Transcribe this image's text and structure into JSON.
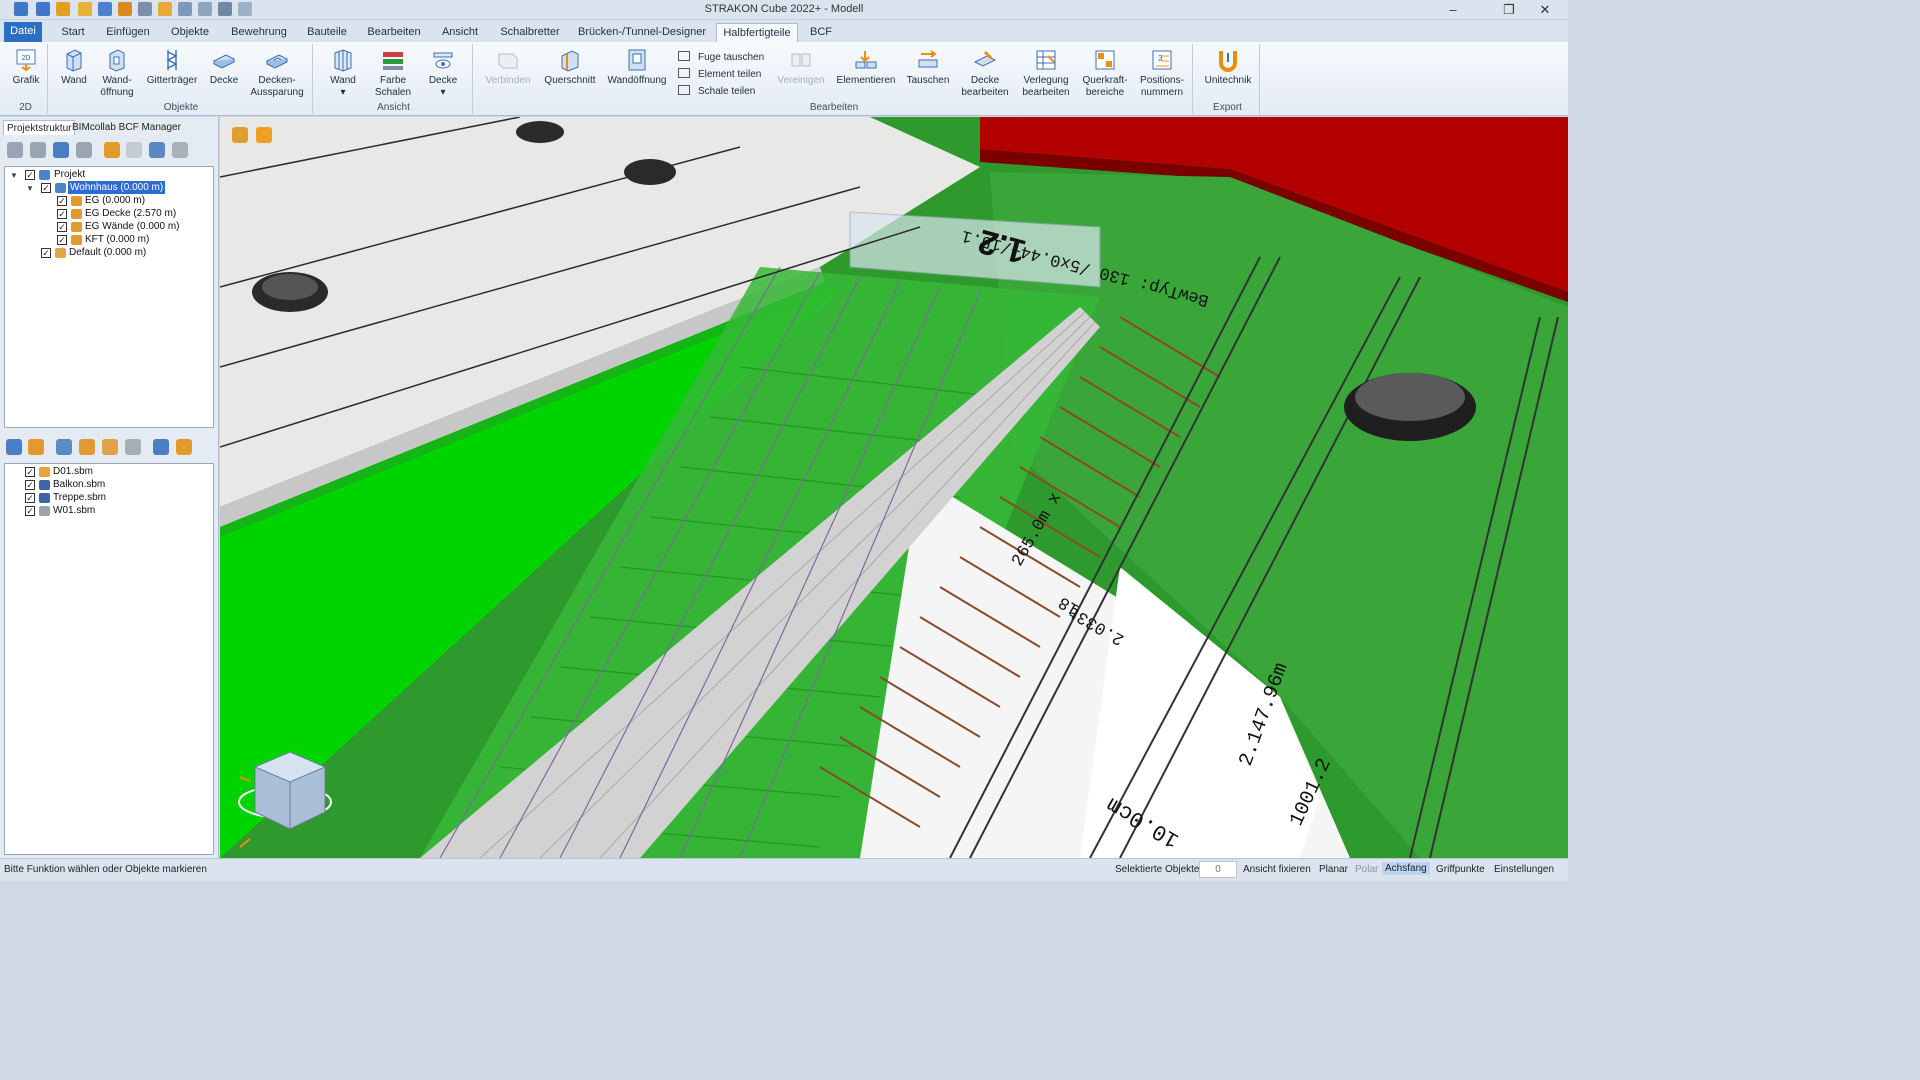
{
  "window": {
    "title": "STRAKON Cube 2022+ - Modell",
    "colors": {
      "chrome": "#dbe4ee",
      "file_tab": "#2b6ec4",
      "selection": "#2c6cd4",
      "green_slab": "#2e9a2e",
      "bright_green": "#00d400",
      "red_wall": "#b30000"
    }
  },
  "quick_access": {
    "icons": [
      "undo-icon",
      "redo-icon",
      "save-icon",
      "save-as-icon",
      "open-icon",
      "import-icon",
      "export-icon",
      "print-icon",
      "copy-icon",
      "paste-icon",
      "properties-icon",
      "layers-icon"
    ]
  },
  "tabs": [
    {
      "label": "Datei"
    },
    {
      "label": "Start"
    },
    {
      "label": "Einfügen"
    },
    {
      "label": "Objekte"
    },
    {
      "label": "Bewehrung"
    },
    {
      "label": "Bauteile"
    },
    {
      "label": "Bearbeiten"
    },
    {
      "label": "Ansicht"
    },
    {
      "label": "Schalbretter"
    },
    {
      "label": "Brücken-/Tunnel-Designer"
    },
    {
      "label": "Halbfertigteile"
    },
    {
      "label": "BCF"
    }
  ],
  "ribbon": {
    "groups": {
      "g2d": "2D",
      "objekte": "Objekte",
      "ansicht": "Ansicht",
      "bearbeiten": "Bearbeiten",
      "export": "Export"
    },
    "grafik": {
      "l1": "Grafik",
      "l2": ""
    },
    "wand": {
      "l1": "Wand",
      "l2": ""
    },
    "wandoeffnung": {
      "l1": "Wand-",
      "l2": "öffnung"
    },
    "gittertraeger": {
      "l1": "Gitterträger",
      "l2": ""
    },
    "decke": {
      "l1": "Decke",
      "l2": ""
    },
    "deckenaussparung": {
      "l1": "Decken-",
      "l2": "Aussparung"
    },
    "ansicht_wand": {
      "l1": "Wand",
      "l2": "▾"
    },
    "farbe_schalen": {
      "l1": "Farbe",
      "l2": "Schalen"
    },
    "ansicht_decke": {
      "l1": "Decke",
      "l2": "▾"
    },
    "verbinden": {
      "l1": "Verbinden",
      "l2": ""
    },
    "querschnitt": {
      "l1": "Querschnitt",
      "l2": ""
    },
    "wandoeffnung2": {
      "l1": "Wandöffnung",
      "l2": ""
    },
    "fuge_tauschen": "Fuge tauschen",
    "element_teilen": "Element teilen",
    "schale_teilen": "Schale teilen",
    "vereinigen": {
      "l1": "Vereinigen",
      "l2": ""
    },
    "elementieren": {
      "l1": "Elementieren",
      "l2": ""
    },
    "tauschen": {
      "l1": "Tauschen",
      "l2": ""
    },
    "decke_bearbeiten": {
      "l1": "Decke",
      "l2": "bearbeiten"
    },
    "verlegung_bearbeiten": {
      "l1": "Verlegung",
      "l2": "bearbeiten"
    },
    "querkraftbereiche": {
      "l1": "Querkraft-",
      "l2": "bereiche"
    },
    "positionsnummern": {
      "l1": "Positions-",
      "l2": "nummern"
    },
    "unitechnik": {
      "l1": "Unitechnik",
      "l2": ""
    }
  },
  "left_panel": {
    "tabs": [
      "Projektstruktur",
      "BIMcollab BCF Manager"
    ],
    "toolbar_icons": [
      "layer-stack-icon",
      "arrow-up-icon",
      "home-up-icon",
      "arrow-up-outline-icon",
      "pencil-icon",
      "delete-icon",
      "snowflake-settings-icon",
      "settings-cloud-icon"
    ],
    "tree": [
      {
        "label": "Projekt",
        "level": 0,
        "checked": true
      },
      {
        "label": "Wohnhaus (0.000 m)",
        "level": 1,
        "checked": true,
        "selected": true
      },
      {
        "label": "EG (0.000 m)",
        "level": 2,
        "checked": true
      },
      {
        "label": "EG Decke (2.570 m)",
        "level": 2,
        "checked": true
      },
      {
        "label": "EG Wände (0.000 m)",
        "level": 2,
        "checked": true
      },
      {
        "label": "KFT (0.000 m)",
        "level": 2,
        "checked": true
      },
      {
        "label": "Default (0.000 m)",
        "level": 1,
        "checked": true
      }
    ],
    "toolbar2_icons": [
      "add-model-icon",
      "ifc-import-icon",
      "sort-icon",
      "announce-icon",
      "share-icon",
      "user-settings-icon",
      "link-icon",
      "refresh-icon"
    ],
    "files": [
      {
        "label": "D01.sbm",
        "checked": true
      },
      {
        "label": "Balkon.sbm",
        "checked": true
      },
      {
        "label": "Treppe.sbm",
        "checked": true
      },
      {
        "label": "W01.sbm",
        "checked": true
      }
    ]
  },
  "viewport": {
    "view_icons": [
      "camera-view-icon",
      "box-3d-icon"
    ],
    "labels": {
      "a": "1.2",
      "b": "BewTyp: 130 /5x0.44+/15.1",
      "c": "18",
      "d": "2.033t",
      "e": "265.0m x",
      "f": "2.147.96m",
      "g": "1001.2",
      "h": "10.0cm"
    }
  },
  "statusbar": {
    "message": "Bitte Funktion wählen oder Objekte markieren",
    "selected_label": "Selektierte Objekte",
    "selected_count": "0",
    "toggles": {
      "a": "Ansicht fixieren",
      "b": "Planar",
      "c": "Polar",
      "d": "Achsfang",
      "e": "Griffpunkte",
      "f": "Einstellungen"
    }
  }
}
